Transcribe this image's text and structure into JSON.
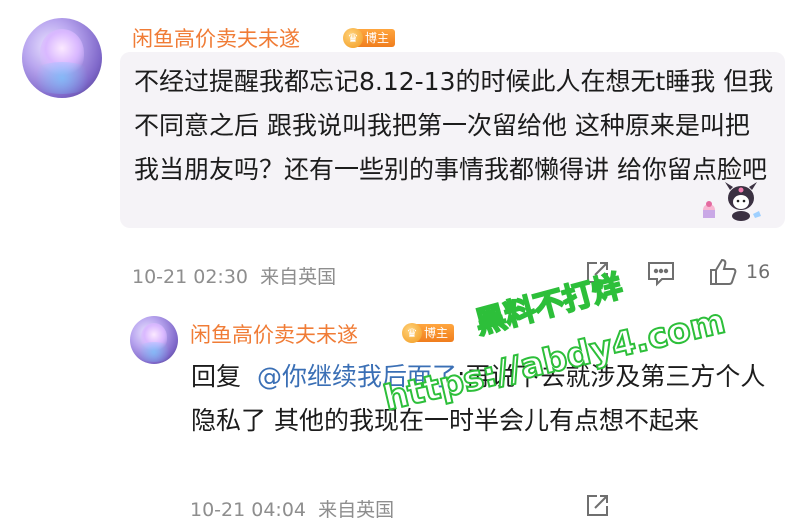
{
  "comment": {
    "username": "闲鱼高价卖夫未遂",
    "badge_icon": "crown-icon",
    "badge_label": "博主",
    "text": "不经过提醒我都忘记8.12-13的时候此人在想无t睡我 但我不同意之后 跟我说叫我把第一次留给他 这种原来是叫把我当朋友吗？还有一些别的事情我都懒得讲 给你留点脸吧",
    "timestamp": "10-21 02:30",
    "location": "来自英国",
    "like_count": "16"
  },
  "reply": {
    "username": "闲鱼高价卖夫未遂",
    "badge_icon": "crown-icon",
    "badge_label": "博主",
    "prefix": "回复",
    "mention": "@你继续我后面了",
    "text": "再说下去就涉及第三方个人隐私了 其他的我现在一时半会儿有点想不起来",
    "timestamp": "10-21 04:04",
    "location": "来自英国"
  },
  "watermark": {
    "line1": "黑料不打烊",
    "line2": "https://abdy4.com"
  },
  "colors": {
    "username": "#f07c36",
    "badge": "#f07d1d",
    "mention": "#3a6fb5",
    "bubble": "#f5f3f7",
    "watermark_outline": "#2dbf3a"
  }
}
